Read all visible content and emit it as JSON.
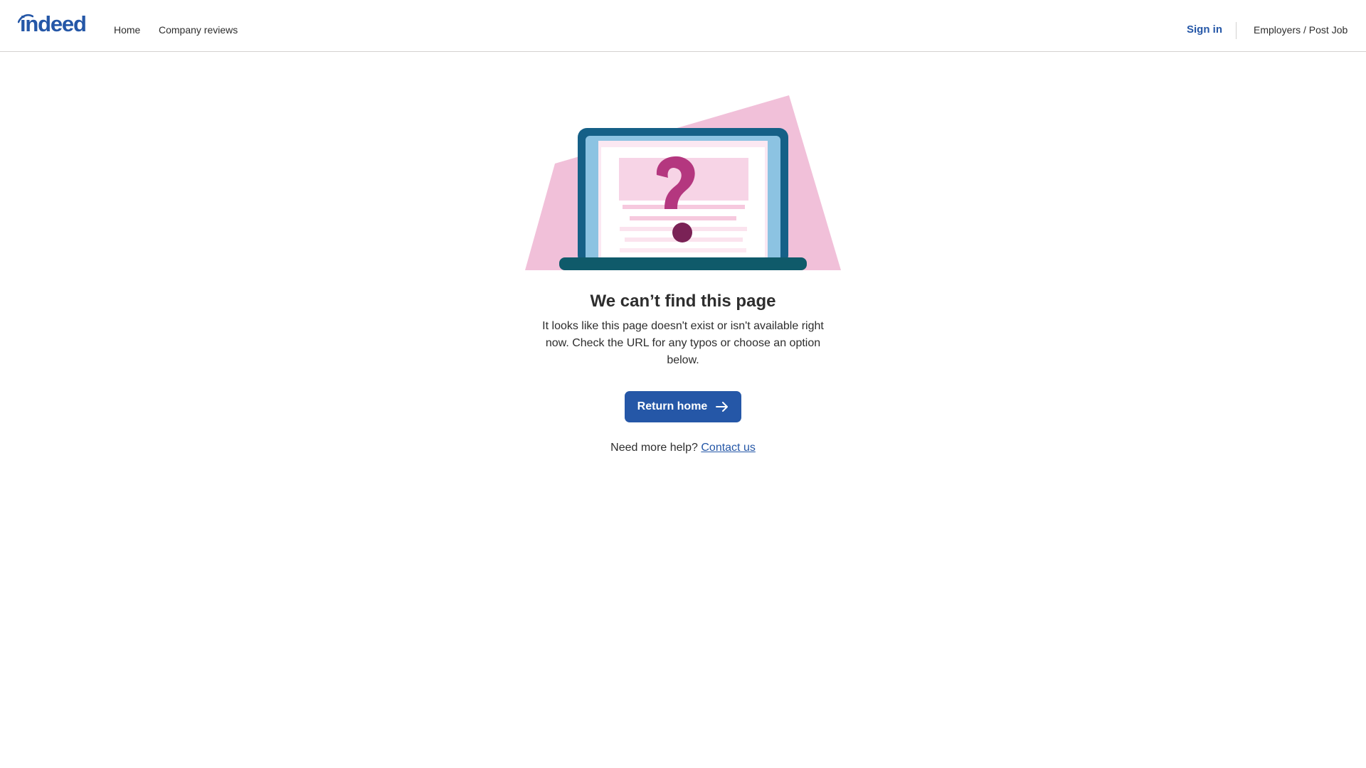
{
  "header": {
    "logo_text": "indeed",
    "nav": [
      {
        "label": "Home"
      },
      {
        "label": "Company reviews"
      }
    ],
    "sign_in": "Sign in",
    "employers": "Employers / Post Job"
  },
  "main": {
    "title": "We can’t find this page",
    "description": "It looks like this page doesn't exist or isn't available right now. Check the URL for any typos or choose an option below.",
    "button_label": "Return home",
    "help_prefix": "Need more help?",
    "help_link": "Contact us"
  },
  "colors": {
    "brand": "#2557a7",
    "illustration_pink": "#f1c0d9",
    "laptop_teal": "#156087",
    "question_magenta": "#b4377f"
  },
  "icons": [
    "indeed-logo-arc-icon",
    "arrow-right-icon",
    "laptop-question-illustration"
  ]
}
